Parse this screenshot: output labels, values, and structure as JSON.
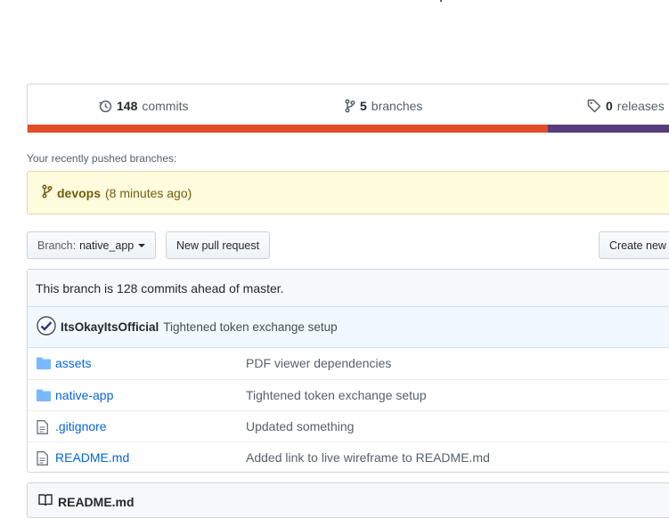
{
  "summary": {
    "commits": {
      "count": "148",
      "label": "commits"
    },
    "branches": {
      "count": "5",
      "label": "branches"
    },
    "releases": {
      "count": "0",
      "label": "releases"
    },
    "languages": [
      {
        "color": "#e34c26",
        "share": 0.79
      },
      {
        "color": "#563d7c",
        "share": 0.21
      }
    ]
  },
  "recent": {
    "label": "Your recently pushed branches:",
    "branch": "devops",
    "time": "(8 minutes ago)"
  },
  "toolbar": {
    "branch_prefix": "Branch:",
    "branch_name": "native_app",
    "new_pr": "New pull request",
    "create_new": "Create new"
  },
  "ahead_text": "This branch is 128 commits ahead of master.",
  "latest_commit": {
    "author": "ItsOkayItsOfficial",
    "message": "Tightened token exchange setup"
  },
  "files": [
    {
      "name": "assets",
      "type": "folder",
      "message": "PDF viewer dependencies"
    },
    {
      "name": "native-app",
      "type": "folder",
      "message": "Tightened token exchange setup"
    },
    {
      "name": ".gitignore",
      "type": "file",
      "message": "Updated something"
    },
    {
      "name": "README.md",
      "type": "file",
      "message": "Added link to live wireframe to README.md"
    }
  ],
  "readme_title": "README.md"
}
